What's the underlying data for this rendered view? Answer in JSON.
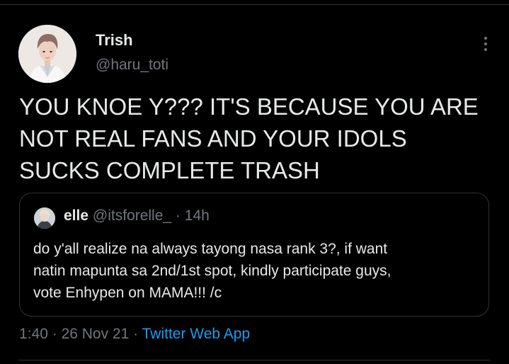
{
  "tweet": {
    "author": {
      "name": "Trish",
      "handle": "@haru_toti"
    },
    "text_lines": [
      "YOU KNOE Y??? IT'S BECAUSE YOU ARE",
      "NOT REAL FANS AND YOUR IDOLS",
      "SUCKS COMPLETE TRASH"
    ],
    "time": "1:40",
    "separator": "·",
    "date": "26 Nov 21",
    "source": "Twitter Web App"
  },
  "quote": {
    "name": "elle",
    "handle": "@itsforelle_",
    "separator": "·",
    "age": "14h",
    "text_lines": [
      "do y'all realize na always tayong nasa rank 3?, if want",
      "natin mapunta sa 2nd/1st spot, kindly participate guys,",
      "vote Enhypen on MAMA!!! /c"
    ]
  },
  "icons": {
    "more": "more-vertical-icon"
  },
  "colors": {
    "background": "#000000",
    "text": "#e7e9ea",
    "muted": "#71767b",
    "link": "#1d9bf0",
    "border": "#2f3336"
  }
}
